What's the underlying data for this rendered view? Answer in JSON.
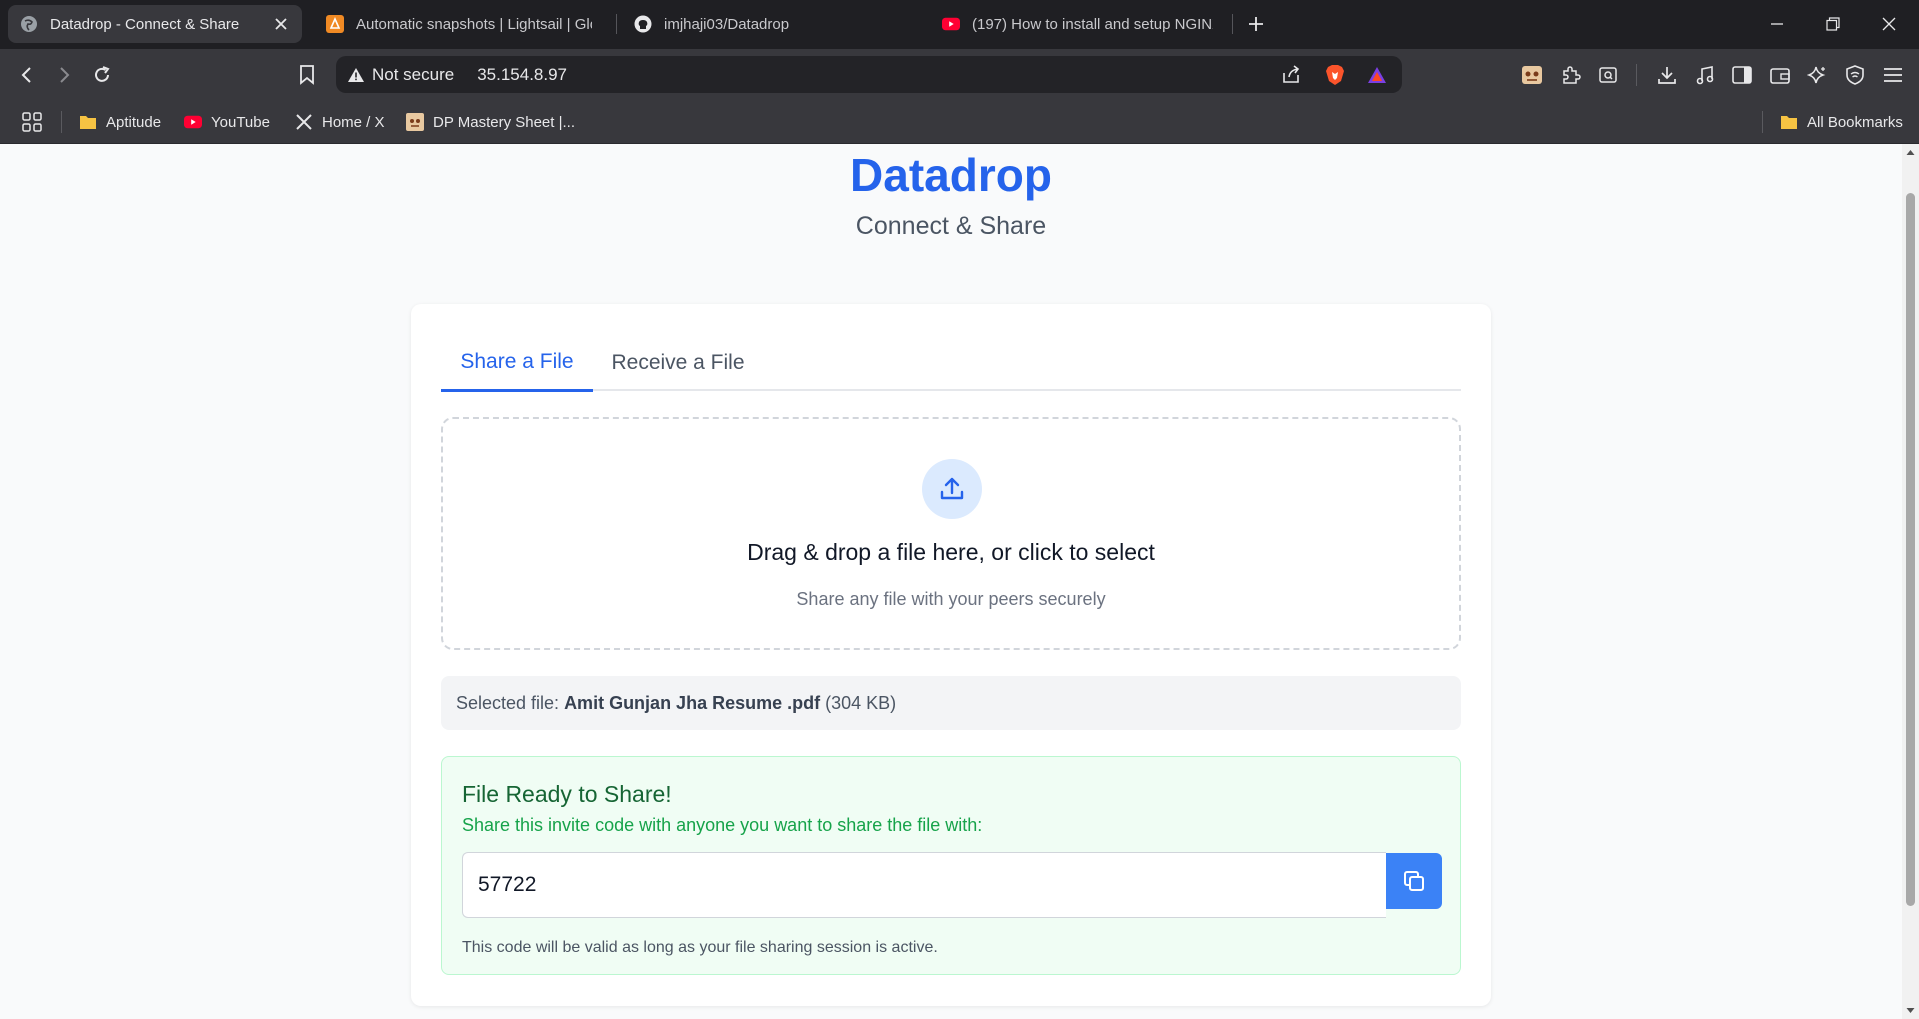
{
  "browser": {
    "tabs": [
      {
        "title": "Datadrop - Connect & Share",
        "icon": "globe-icon",
        "active": true
      },
      {
        "title": "Automatic snapshots | Lightsail | Glob",
        "icon": "lightsail-icon",
        "active": false
      },
      {
        "title": "imjhaji03/Datadrop",
        "icon": "github-icon",
        "active": false
      },
      {
        "title": "(197) How to install and setup NGINX",
        "icon": "youtube-icon",
        "active": false
      }
    ],
    "security_label": "Not secure",
    "url": "35.154.8.97",
    "bookmarks": [
      {
        "label": "Aptitude",
        "icon": "folder-icon"
      },
      {
        "label": "YouTube",
        "icon": "youtube-icon"
      },
      {
        "label": "Home / X",
        "icon": "x-icon"
      },
      {
        "label": "DP Mastery Sheet |...",
        "icon": "sheet-icon"
      }
    ],
    "all_bookmarks_label": "All Bookmarks"
  },
  "app": {
    "brand": "Datadrop",
    "tagline": "Connect & Share",
    "tabs": {
      "share": "Share a File",
      "receive": "Receive a File"
    },
    "dropzone": {
      "title": "Drag & drop a file here, or click to select",
      "subtitle": "Share any file with your peers securely"
    },
    "selected_file": {
      "prefix": "Selected file:",
      "name": "Amit Gunjan Jha Resume .pdf",
      "size": "(304 KB)"
    },
    "ready": {
      "title": "File Ready to Share!",
      "subtitle": "Share this invite code with anyone you want to share the file with:",
      "code": "57722",
      "note": "This code will be valid as long as your file sharing session is active."
    }
  },
  "colors": {
    "brand_blue": "#2563eb",
    "copy_button": "#3b82f6",
    "success_bg": "#f0fdf4",
    "success_text": "#166534",
    "chrome_dark": "#1f1f23"
  }
}
